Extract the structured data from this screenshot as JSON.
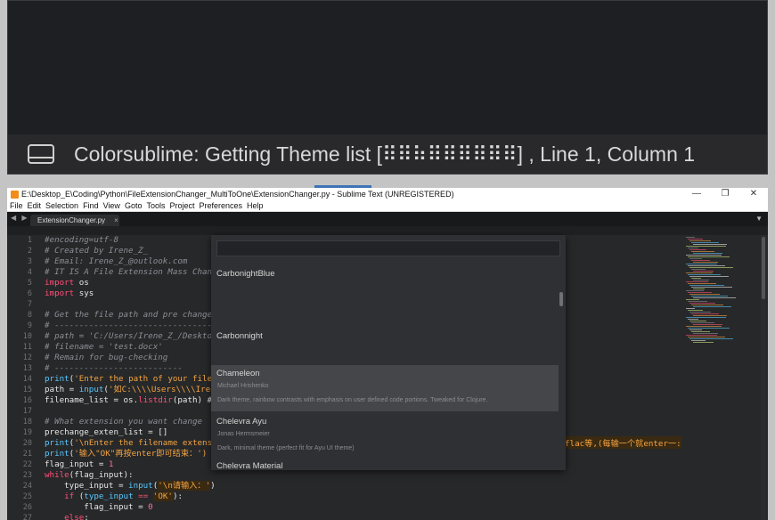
{
  "zoom": {
    "status_text": "Colorsublime: Getting Theme list [⠿⠿⠷⠿⠿⠿⠿⠿⠿] , Line 1, Column 1"
  },
  "window": {
    "title": "E:\\Desktop_E\\Coding\\Python\\FileExtensionChanger_MultiToOne\\ExtensionChanger.py - Sublime Text (UNREGISTERED)",
    "controls": {
      "minimize": "—",
      "maximize": "❐",
      "close": "✕"
    }
  },
  "menu": [
    "File",
    "Edit",
    "Selection",
    "Find",
    "View",
    "Goto",
    "Tools",
    "Project",
    "Preferences",
    "Help"
  ],
  "tabs": {
    "nav": "◀ ▶",
    "active": {
      "label": "ExtensionChanger.py",
      "close": "×"
    },
    "dropdown": "▼"
  },
  "editor": {
    "line_numbers": [
      "1",
      "2",
      "3",
      "4",
      "5",
      "6",
      "7",
      "8",
      "9",
      "10",
      "11",
      "12",
      "13",
      "14",
      "15",
      "16",
      "17",
      "18",
      "19",
      "20",
      "21",
      "22",
      "23",
      "24",
      "25",
      "26",
      "27"
    ],
    "right_overflow_text": "flac等,(每输一个就enter一:"
  },
  "palette": {
    "items": [
      {
        "name": "CarbonightBlue",
        "author": "",
        "desc": ""
      },
      {
        "name": "Carbonnight",
        "author": "",
        "desc": ""
      },
      {
        "name": "Chameleon",
        "author": "Michael Hrishenko",
        "desc": "Dark theme, rainbow contrasts with emphasis on user defined code portions. Tweaked for Clojure.",
        "selected": true
      },
      {
        "name": "Chelevra Ayu",
        "author": "Jonas Hermsmeier",
        "desc": "Dark, minimal theme (perfect fit for Ayu UI theme)"
      },
      {
        "name": "Chelevra Material",
        "author": "",
        "desc": ""
      }
    ]
  },
  "colors": {
    "accent": "#f28b18",
    "background": "#272829",
    "keyword": "#ff4f7a",
    "string": "#f4a443",
    "function": "#57c8ff"
  }
}
